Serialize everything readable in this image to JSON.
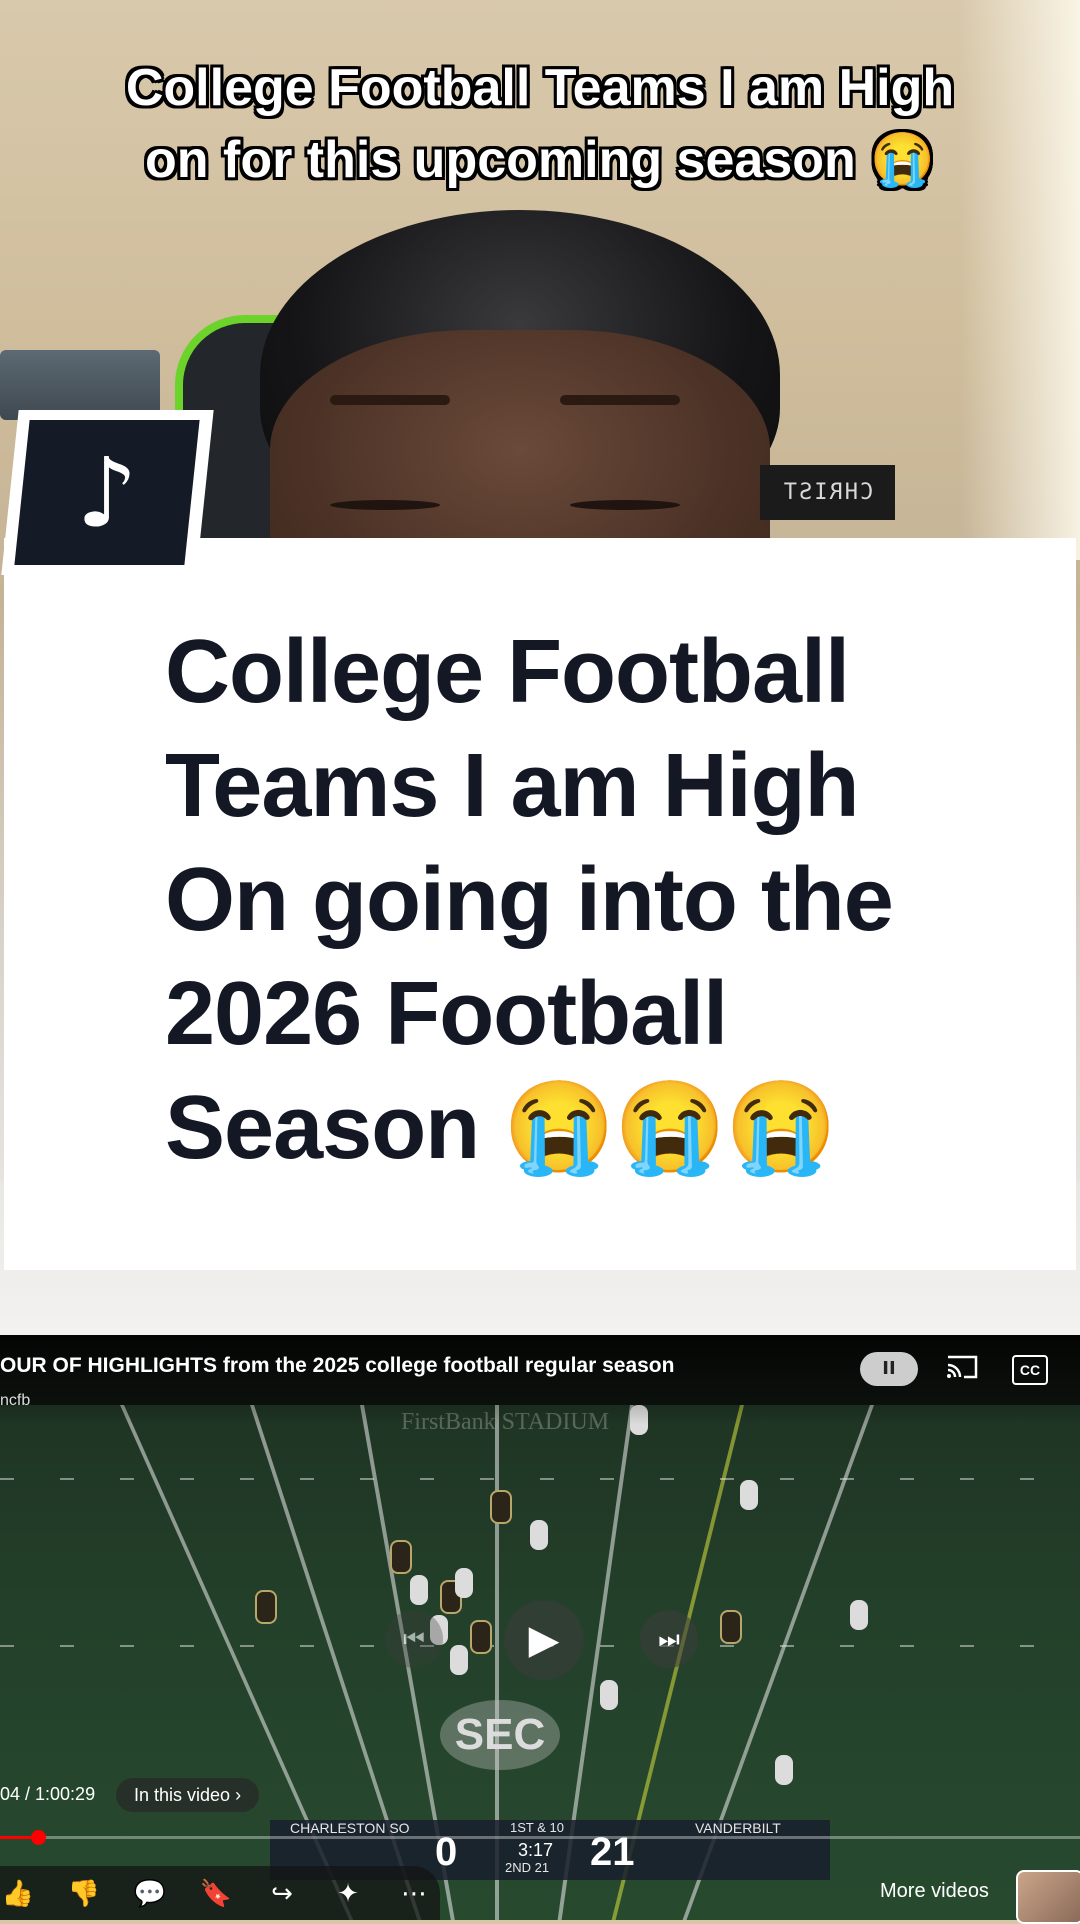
{
  "overlay": {
    "caption_line1": "College Football Teams I am High",
    "caption_line2": "on for this upcoming season 😭",
    "shirt_text": "CHRIST"
  },
  "title_card": {
    "line1": "College Football",
    "line2": "Teams I am High",
    "line3": "On going into the",
    "line4": "2026 Football",
    "line5": "Season 😭😭😭"
  },
  "tiktok": {
    "icon": "tiktok-logo-icon",
    "glyph": "♪"
  },
  "video": {
    "title": "OUR OF HIGHLIGHTS from the 2025 college football regular season",
    "channel": "ncfb",
    "stadium": "FirstBank STADIUM",
    "logo": "SEC",
    "time": "04 / 1:00:29",
    "in_this_video": "In this video",
    "progress_fraction": 0.035,
    "pause_glyph": "II",
    "cc_label": "CC",
    "controls": {
      "prev": "⏮",
      "play": "▶",
      "next": "⏭"
    },
    "more_videos": "More videos"
  },
  "scorebug": {
    "team1": "CHARLESTON SO",
    "team2": "VANDERBILT",
    "score1": "0",
    "score2": "21",
    "down": "1ST & 10",
    "clock": "3:17",
    "period": "2ND  21"
  },
  "actions": [
    {
      "name": "like-icon",
      "glyph": "👍"
    },
    {
      "name": "dislike-icon",
      "glyph": "👎"
    },
    {
      "name": "comments-icon",
      "glyph": "💬"
    },
    {
      "name": "save-icon",
      "glyph": "🔖"
    },
    {
      "name": "share-icon",
      "glyph": "↪"
    },
    {
      "name": "remix-icon",
      "glyph": "✦"
    },
    {
      "name": "more-icon",
      "glyph": "⋯"
    }
  ],
  "colors": {
    "card_text": "#141824",
    "progress": "#ff0000",
    "accent_green": "#6bd32a"
  }
}
